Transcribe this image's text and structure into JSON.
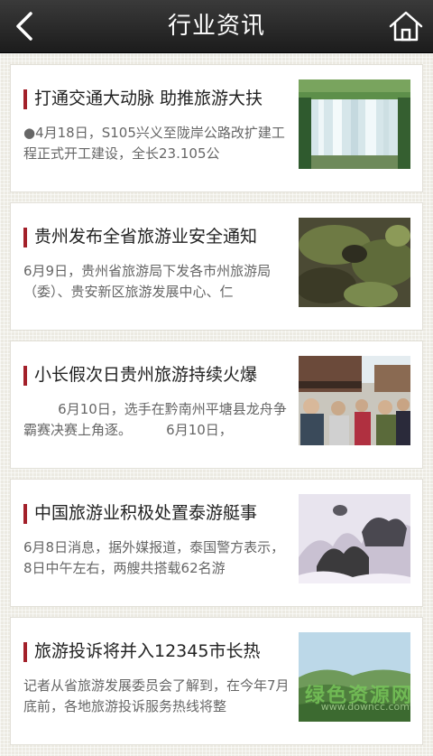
{
  "header": {
    "title": "行业资讯",
    "back_icon": "chevron-left-icon",
    "home_icon": "home-icon"
  },
  "articles": [
    {
      "title": "打通交通大动脉 助推旅游大扶",
      "summary": "●4月18日，S105兴义至陇岸公路改扩建工程正式开工建设，全长23.105公",
      "image": "waterfall"
    },
    {
      "title": "贵州发布全省旅游业安全通知",
      "summary": "6月9日，贵州省旅游局下发各市州旅游局（委）、贵安新区旅游发展中心、仁",
      "image": "mossy-rock"
    },
    {
      "title": "小长假次日贵州旅游持续火爆",
      "summary": "        6月10日，选手在黔南州平塘县龙舟争霸赛决赛上角逐。        6月10日，",
      "image": "crowded-street"
    },
    {
      "title": "中国旅游业积极处置泰游艇事",
      "summary": "6月8日消息，据外媒报道，泰国警方表示，8日中午左右，两艘共搭载62名游",
      "image": "misty-mountains"
    },
    {
      "title": "旅游投诉将并入12345市长热",
      "summary": "记者从省旅游发展委员会了解到，在今年7月底前，各地旅游投诉服务热线将整",
      "image": "forest-hills"
    }
  ],
  "watermark": {
    "main": "绿色资源网",
    "sub": "www.downcc.com"
  },
  "colors": {
    "header_bg": "#262626",
    "accent_bar": "#a3202a",
    "page_bg": "#eceae2"
  }
}
